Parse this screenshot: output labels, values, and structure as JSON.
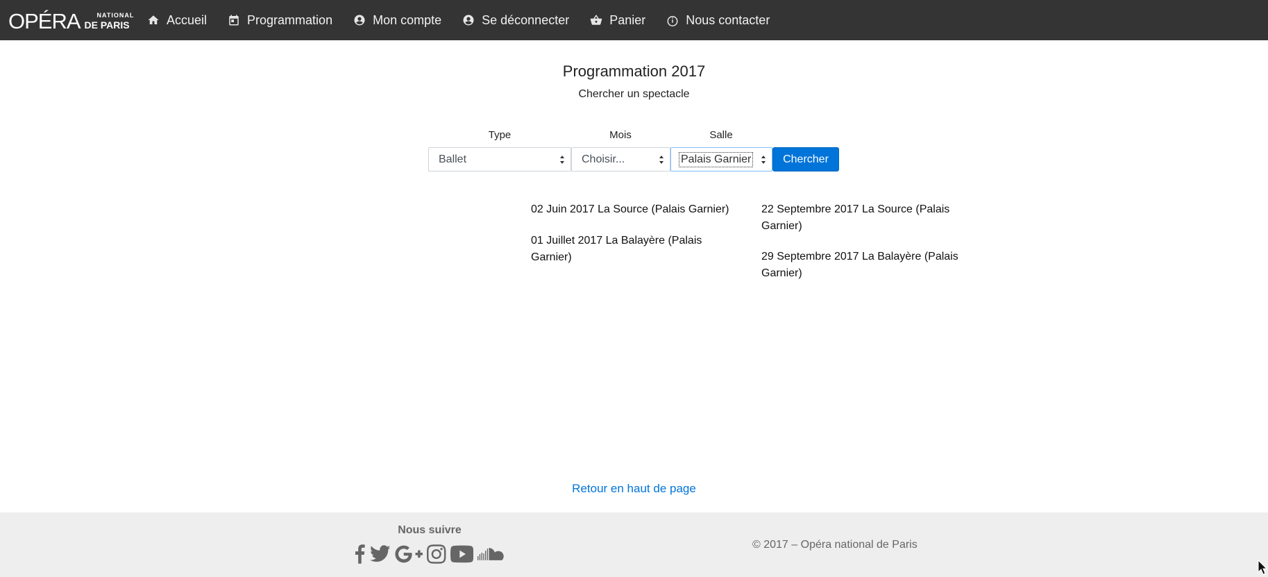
{
  "header": {
    "logo": {
      "main": "OPÉRA",
      "line1": "NATIONAL",
      "line2": "DE PARIS"
    },
    "nav": [
      {
        "label": "Accueil",
        "icon": "home-icon"
      },
      {
        "label": "Programmation",
        "icon": "calendar-icon"
      },
      {
        "label": "Mon compte",
        "icon": "user-circle-icon"
      },
      {
        "label": "Se déconnecter",
        "icon": "user-circle-icon"
      },
      {
        "label": "Panier",
        "icon": "basket-icon"
      },
      {
        "label": "Nous contacter",
        "icon": "info-icon"
      }
    ]
  },
  "main": {
    "title": "Programmation 2017",
    "subtitle": "Chercher un spectacle",
    "filters": {
      "type": {
        "label": "Type",
        "value": "Ballet"
      },
      "mois": {
        "label": "Mois",
        "value": "Choisir..."
      },
      "salle": {
        "label": "Salle",
        "value": "Palais Garnier"
      },
      "button": "Chercher"
    },
    "results": [
      "02 Juin 2017 La Source (Palais Garnier)",
      "01 Juillet 2017 La Balayère (Palais Garnier)",
      "22 Septembre 2017 La Source (Palais Garnier)",
      "29 Septembre 2017 La Balayère (Palais Garnier)"
    ],
    "back_to_top": "Retour en haut de page"
  },
  "footer": {
    "follow": "Nous suivre",
    "socials": [
      "facebook-icon",
      "twitter-icon",
      "google-plus-icon",
      "instagram-icon",
      "youtube-icon",
      "soundcloud-icon"
    ],
    "copyright": "© 2017 – Opéra national de Paris"
  },
  "colors": {
    "navbar": "#343434",
    "accent": "#0074d9",
    "footer": "#eeeeee"
  }
}
